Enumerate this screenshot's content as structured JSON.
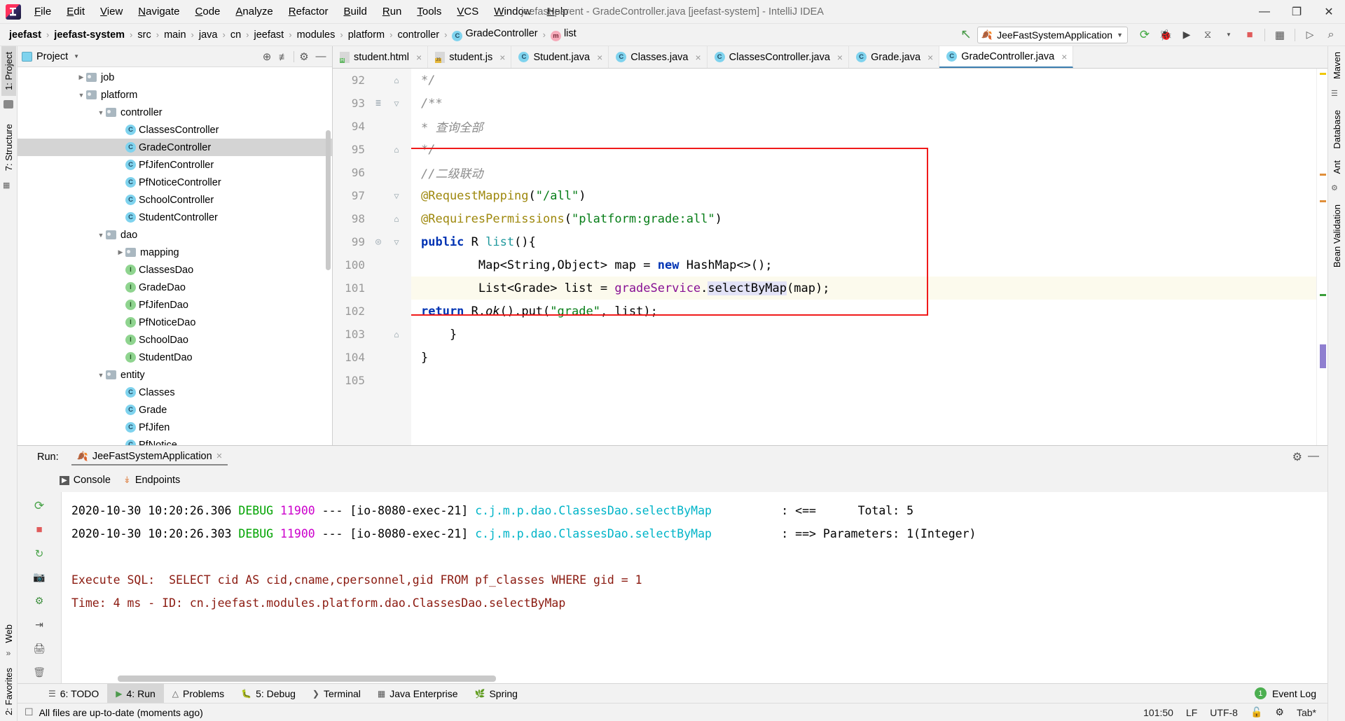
{
  "window": {
    "title": "jeefast-parent - GradeController.java [jeefast-system] - IntelliJ IDEA",
    "minimize": "—",
    "maximize": "❐",
    "close": "✕"
  },
  "menubar": {
    "items": [
      "File",
      "Edit",
      "View",
      "Navigate",
      "Code",
      "Analyze",
      "Refactor",
      "Build",
      "Run",
      "Tools",
      "VCS",
      "Window",
      "Help"
    ]
  },
  "breadcrumb": {
    "items": [
      {
        "label": "jeefast",
        "bold": true,
        "icon": ""
      },
      {
        "label": "jeefast-system",
        "bold": true,
        "icon": ""
      },
      {
        "label": "src",
        "bold": false,
        "icon": ""
      },
      {
        "label": "main",
        "bold": false,
        "icon": ""
      },
      {
        "label": "java",
        "bold": false,
        "icon": ""
      },
      {
        "label": "cn",
        "bold": false,
        "icon": ""
      },
      {
        "label": "jeefast",
        "bold": false,
        "icon": ""
      },
      {
        "label": "modules",
        "bold": false,
        "icon": ""
      },
      {
        "label": "platform",
        "bold": false,
        "icon": ""
      },
      {
        "label": "controller",
        "bold": false,
        "icon": ""
      },
      {
        "label": "GradeController",
        "bold": false,
        "icon": "class-icon"
      },
      {
        "label": "list",
        "bold": false,
        "icon": "method-icon"
      }
    ],
    "separator": "›"
  },
  "toolbar": {
    "run_config": "JeeFastSystemApplication",
    "run_config_caret": "▼",
    "buttons": [
      {
        "name": "run-button",
        "glyph": "⟳"
      },
      {
        "name": "debug-button",
        "glyph": "🐞"
      },
      {
        "name": "run-with-coverage-button",
        "glyph": "▶"
      },
      {
        "name": "profiler-button",
        "glyph": "⧖"
      },
      {
        "name": "stop-button",
        "glyph": "■"
      },
      {
        "name": "project-structure-button",
        "glyph": "▦"
      },
      {
        "name": "terminal-button",
        "glyph": "▷"
      },
      {
        "name": "search-everywhere-button",
        "glyph": "⌕"
      }
    ]
  },
  "left_rail": {
    "tabs": [
      "1: Project",
      "7: Structure"
    ],
    "bottom_tabs": [
      "2: Favorites",
      "Web"
    ],
    "expand_glyph": "»"
  },
  "right_rail": {
    "tabs": [
      "Maven",
      "Database",
      "Ant",
      "Bean Validation"
    ]
  },
  "project_panel": {
    "title": "Project",
    "caret": "▼",
    "icons": [
      "locate-icon",
      "collapse-all-icon",
      "gear-icon",
      "hide-icon"
    ],
    "tree": [
      {
        "label": "job",
        "indent": 3,
        "arrow": "▶",
        "kind": "folder"
      },
      {
        "label": "platform",
        "indent": 3,
        "arrow": "▼",
        "kind": "folder"
      },
      {
        "label": "controller",
        "indent": 4,
        "arrow": "▼",
        "kind": "folder"
      },
      {
        "label": "ClassesController",
        "indent": 5,
        "arrow": "",
        "kind": "class"
      },
      {
        "label": "GradeController",
        "indent": 5,
        "arrow": "",
        "kind": "class",
        "selected": true
      },
      {
        "label": "PfJifenController",
        "indent": 5,
        "arrow": "",
        "kind": "class"
      },
      {
        "label": "PfNoticeController",
        "indent": 5,
        "arrow": "",
        "kind": "class"
      },
      {
        "label": "SchoolController",
        "indent": 5,
        "arrow": "",
        "kind": "class"
      },
      {
        "label": "StudentController",
        "indent": 5,
        "arrow": "",
        "kind": "class"
      },
      {
        "label": "dao",
        "indent": 4,
        "arrow": "▼",
        "kind": "folder"
      },
      {
        "label": "mapping",
        "indent": 5,
        "arrow": "▶",
        "kind": "folder"
      },
      {
        "label": "ClassesDao",
        "indent": 5,
        "arrow": "",
        "kind": "interface"
      },
      {
        "label": "GradeDao",
        "indent": 5,
        "arrow": "",
        "kind": "interface"
      },
      {
        "label": "PfJifenDao",
        "indent": 5,
        "arrow": "",
        "kind": "interface"
      },
      {
        "label": "PfNoticeDao",
        "indent": 5,
        "arrow": "",
        "kind": "interface"
      },
      {
        "label": "SchoolDao",
        "indent": 5,
        "arrow": "",
        "kind": "interface"
      },
      {
        "label": "StudentDao",
        "indent": 5,
        "arrow": "",
        "kind": "interface"
      },
      {
        "label": "entity",
        "indent": 4,
        "arrow": "▼",
        "kind": "folder"
      },
      {
        "label": "Classes",
        "indent": 5,
        "arrow": "",
        "kind": "class"
      },
      {
        "label": "Grade",
        "indent": 5,
        "arrow": "",
        "kind": "class"
      },
      {
        "label": "PfJifen",
        "indent": 5,
        "arrow": "",
        "kind": "class"
      },
      {
        "label": "PfNotice",
        "indent": 5,
        "arrow": "",
        "kind": "class"
      }
    ]
  },
  "editor": {
    "tabs": [
      {
        "label": "student.html",
        "icon": "html-file-icon",
        "active": false
      },
      {
        "label": "student.js",
        "icon": "js-file-icon",
        "active": false
      },
      {
        "label": "Student.java",
        "icon": "class-icon",
        "active": false
      },
      {
        "label": "Classes.java",
        "icon": "class-icon",
        "active": false
      },
      {
        "label": "ClassesController.java",
        "icon": "class-icon",
        "active": false
      },
      {
        "label": "Grade.java",
        "icon": "class-icon",
        "active": false
      },
      {
        "label": "GradeController.java",
        "icon": "class-icon",
        "active": true
      }
    ],
    "close_glyph": "×",
    "lines": [
      {
        "num": "92",
        "fold": "⌂",
        "mark": "",
        "html": "    <span class='cmt'>*/</span>"
      },
      {
        "num": "93",
        "fold": "▽",
        "mark": "≣",
        "html": "    <span class='cmt'>/**</span>"
      },
      {
        "num": "94",
        "fold": "",
        "mark": "",
        "html": "     <span class='cmt'>* 查询全部</span>"
      },
      {
        "num": "95",
        "fold": "⌂",
        "mark": "",
        "html": "     <span class='cmt'>*/</span>"
      },
      {
        "num": "96",
        "fold": "",
        "mark": "",
        "html": "    <span class='cmt'>//二级联动</span>"
      },
      {
        "num": "97",
        "fold": "▽",
        "mark": "",
        "html": "    <span class='ann'>@RequestMapping</span>(<span class='str'>\"/all\"</span>)"
      },
      {
        "num": "98",
        "fold": "⌂",
        "mark": "",
        "html": "    <span class='ann'>@RequiresPermissions</span>(<span class='str'>\"platform:grade:all\"</span>)"
      },
      {
        "num": "99",
        "fold": "▽",
        "mark": "◎",
        "html": "    <span class='kw'>public</span> R <span class='typ'>list</span>(){"
      },
      {
        "num": "100",
        "fold": "",
        "mark": "",
        "html": "        Map&lt;String,Object&gt; map = <span class='kw'>new</span> HashMap&lt;&gt;();"
      },
      {
        "num": "101",
        "fold": "",
        "mark": "",
        "hl": true,
        "html": "        List&lt;Grade&gt; list = <span class='fld'>gradeService</span>.<span class='sel'>selectByMap</span>(map);"
      },
      {
        "num": "102",
        "fold": "",
        "mark": "",
        "html": "        <span class='kw'>return</span> R.<span class='mth2'>ok</span>().put(<span class='str'>\"grade\"</span>, list);"
      },
      {
        "num": "103",
        "fold": "⌂",
        "mark": "",
        "html": "    }"
      },
      {
        "num": "104",
        "fold": "",
        "mark": "",
        "html": "}"
      },
      {
        "num": "105",
        "fold": "",
        "mark": "",
        "html": ""
      }
    ]
  },
  "run_panel": {
    "label": "Run:",
    "config_name": "JeeFastSystemApplication",
    "close_glyph": "×",
    "subtabs": [
      {
        "label": "Console",
        "icon": "console-icon"
      },
      {
        "label": "Endpoints",
        "icon": "endpoints-icon"
      }
    ],
    "settings_icon": "gear-icon",
    "hide_icon": "minimize-icon",
    "console_lines": [
      {
        "segments": [
          {
            "t": "Time: 4 ms - ID: cn.jeefast.modules.platform.dao.ClassesDao.selectByMap",
            "c": "c-dark"
          }
        ]
      },
      {
        "segments": [
          {
            "t": "Execute SQL:  SELECT cid AS cid,cname,cpersonnel,gid FROM pf_classes WHERE gid = 1",
            "c": "c-dark"
          }
        ]
      },
      {
        "segments": []
      },
      {
        "segments": [
          {
            "t": "2020-10-30 10:20:26.303 ",
            "c": "c-plain"
          },
          {
            "t": "DEBUG ",
            "c": "c-green"
          },
          {
            "t": "11900",
            "c": "c-mag"
          },
          {
            "t": " --- [io-8080-exec-21] ",
            "c": "c-plain"
          },
          {
            "t": "c.j.m.p.dao.ClassesDao.selectByMap",
            "c": "c-cyan"
          },
          {
            "t": "          : ==> Parameters: 1(Integer)",
            "c": "c-plain"
          }
        ]
      },
      {
        "segments": [
          {
            "t": "2020-10-30 10:20:26.306 ",
            "c": "c-plain"
          },
          {
            "t": "DEBUG ",
            "c": "c-green"
          },
          {
            "t": "11900",
            "c": "c-mag"
          },
          {
            "t": " --- [io-8080-exec-21] ",
            "c": "c-plain"
          },
          {
            "t": "c.j.m.p.dao.ClassesDao.selectByMap",
            "c": "c-cyan"
          },
          {
            "t": "          : <==      Total: 5",
            "c": "c-plain"
          }
        ]
      }
    ]
  },
  "bottom_tabs": {
    "items": [
      {
        "label": "6: TODO",
        "icon": "todo-icon",
        "active": false
      },
      {
        "label": "4: Run",
        "icon": "run-icon",
        "active": true
      },
      {
        "label": "Problems",
        "icon": "warning-icon",
        "active": false
      },
      {
        "label": "5: Debug",
        "icon": "debug-icon",
        "active": false
      },
      {
        "label": "Terminal",
        "icon": "terminal-icon",
        "active": false
      },
      {
        "label": "Java Enterprise",
        "icon": "jee-icon",
        "active": false
      },
      {
        "label": "Spring",
        "icon": "spring-icon",
        "active": false
      }
    ],
    "event_log": "Event Log",
    "event_log_count": "1"
  },
  "statusbar": {
    "message": "All files are up-to-date (moments ago)",
    "caret_position": "101:50",
    "line_separator": "LF",
    "encoding": "UTF-8",
    "lock_icon": "lock-icon",
    "inspection_icon": "inspector-icon",
    "indent": "Tab*"
  },
  "colors": {
    "accent_blue": "#3c7fb1",
    "keyword": "#0033b3",
    "string": "#067d17",
    "annotation": "#9e880d",
    "comment": "#8c8c8c",
    "field": "#871094",
    "highlight_box": "#f01a1a",
    "green": "#4caf50"
  }
}
